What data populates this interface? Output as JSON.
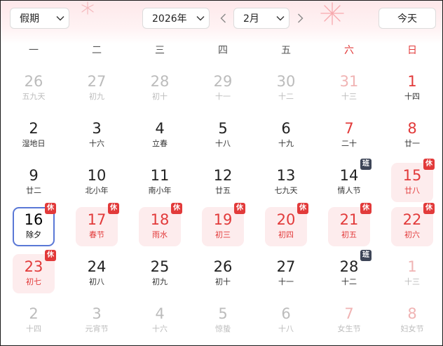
{
  "toolbar": {
    "holiday_select": "假期",
    "year_select": "2026年",
    "month_select": "2月",
    "today_button": "今天"
  },
  "weekdays": [
    "一",
    "二",
    "三",
    "四",
    "五",
    "六",
    "日"
  ],
  "colors": {
    "holiday_red": "#e23a3a",
    "holiday_bg": "#fdeced",
    "workday_badge": "#3d4557",
    "selected_border": "#5a78d6"
  },
  "days": [
    {
      "day": "26",
      "sub": "五九天",
      "kind": "dim"
    },
    {
      "day": "27",
      "sub": "初九",
      "kind": "dim"
    },
    {
      "day": "28",
      "sub": "初十",
      "kind": "dim"
    },
    {
      "day": "29",
      "sub": "十一",
      "kind": "dim"
    },
    {
      "day": "30",
      "sub": "十二",
      "kind": "dim"
    },
    {
      "day": "31",
      "sub": "十三",
      "kind": "wkdim"
    },
    {
      "day": "1",
      "sub": "十四",
      "kind": "wkd"
    },
    {
      "day": "2",
      "sub": "湿地日",
      "kind": "std"
    },
    {
      "day": "3",
      "sub": "十六",
      "kind": "std"
    },
    {
      "day": "4",
      "sub": "立春",
      "kind": "std"
    },
    {
      "day": "5",
      "sub": "十八",
      "kind": "std"
    },
    {
      "day": "6",
      "sub": "十九",
      "kind": "std"
    },
    {
      "day": "7",
      "sub": "二十",
      "kind": "wkd"
    },
    {
      "day": "8",
      "sub": "廿一",
      "kind": "wkd"
    },
    {
      "day": "9",
      "sub": "廿二",
      "kind": "std"
    },
    {
      "day": "10",
      "sub": "北小年",
      "kind": "std"
    },
    {
      "day": "11",
      "sub": "南小年",
      "kind": "std"
    },
    {
      "day": "12",
      "sub": "廿五",
      "kind": "std"
    },
    {
      "day": "13",
      "sub": "七九天",
      "kind": "std"
    },
    {
      "day": "14",
      "sub": "情人节",
      "kind": "std",
      "badge": "班"
    },
    {
      "day": "15",
      "sub": "廿八",
      "kind": "hol",
      "badge": "休"
    },
    {
      "day": "16",
      "sub": "除夕",
      "kind": "sel",
      "badge": "休"
    },
    {
      "day": "17",
      "sub": "春节",
      "kind": "hol",
      "badge": "休"
    },
    {
      "day": "18",
      "sub": "雨水",
      "kind": "hol",
      "badge": "休"
    },
    {
      "day": "19",
      "sub": "初三",
      "kind": "hol",
      "badge": "休"
    },
    {
      "day": "20",
      "sub": "初四",
      "kind": "hol",
      "badge": "休"
    },
    {
      "day": "21",
      "sub": "初五",
      "kind": "hol",
      "badge": "休"
    },
    {
      "day": "22",
      "sub": "初六",
      "kind": "hol",
      "badge": "休"
    },
    {
      "day": "23",
      "sub": "初七",
      "kind": "hol",
      "badge": "休"
    },
    {
      "day": "24",
      "sub": "初八",
      "kind": "std"
    },
    {
      "day": "25",
      "sub": "初九",
      "kind": "std"
    },
    {
      "day": "26",
      "sub": "初十",
      "kind": "std"
    },
    {
      "day": "27",
      "sub": "十一",
      "kind": "std"
    },
    {
      "day": "28",
      "sub": "十二",
      "kind": "std",
      "badge": "班"
    },
    {
      "day": "1",
      "sub": "十三",
      "kind": "wkdim"
    },
    {
      "day": "2",
      "sub": "十四",
      "kind": "dim"
    },
    {
      "day": "3",
      "sub": "元宵节",
      "kind": "dim"
    },
    {
      "day": "4",
      "sub": "十六",
      "kind": "dim"
    },
    {
      "day": "5",
      "sub": "惊蛰",
      "kind": "dim"
    },
    {
      "day": "6",
      "sub": "十八",
      "kind": "dim"
    },
    {
      "day": "7",
      "sub": "女生节",
      "kind": "wkdim"
    },
    {
      "day": "8",
      "sub": "妇女节",
      "kind": "wkdim"
    }
  ]
}
